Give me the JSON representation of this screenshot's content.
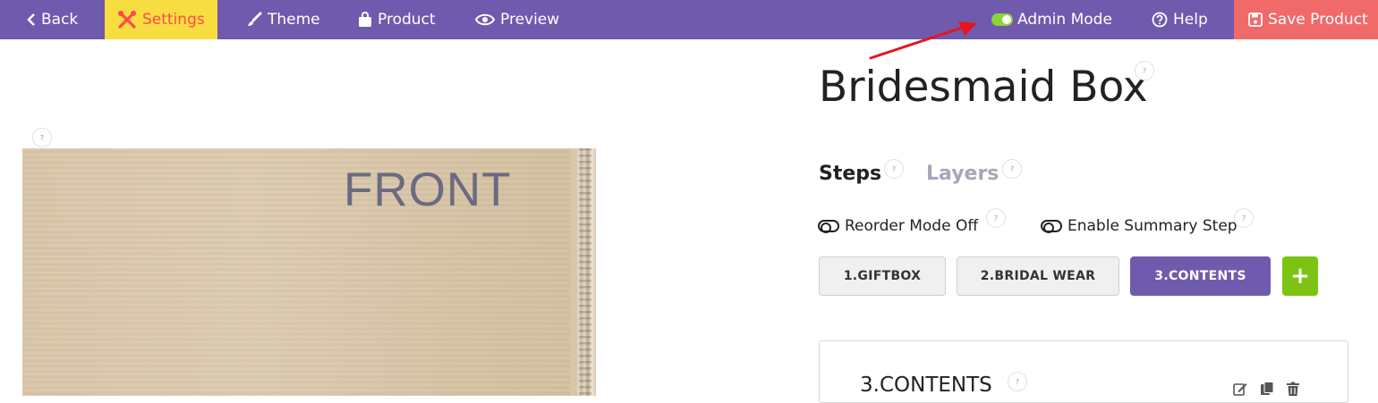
{
  "topbar": {
    "back_label": "Back",
    "settings_label": "Settings",
    "theme_label": "Theme",
    "product_label": "Product",
    "preview_label": "Preview",
    "admin_mode_label": "Admin Mode",
    "help_label": "Help",
    "save_label": "Save Product",
    "colors": {
      "bar": "#6f5aae",
      "settings_bg": "#f7dd3f",
      "settings_fg": "#ff4a4a",
      "save_bg": "#f06a6a",
      "toggle_on": "#8bd43a"
    }
  },
  "canvas": {
    "side_label": "FRONT"
  },
  "product": {
    "title": "Bridesmaid Box"
  },
  "tabs": {
    "steps": "Steps",
    "layers": "Layers",
    "active": "Steps"
  },
  "options": {
    "reorder_label": "Reorder Mode Off",
    "summary_label": "Enable Summary Step"
  },
  "steps": [
    {
      "label": "1.GIFTBOX",
      "active": false
    },
    {
      "label": "2.BRIDAL WEAR",
      "active": false
    },
    {
      "label": "3.CONTENTS",
      "active": true
    }
  ],
  "add_step": {
    "label": "+"
  },
  "help_marker": "?",
  "panel": {
    "title": "3.CONTENTS"
  }
}
